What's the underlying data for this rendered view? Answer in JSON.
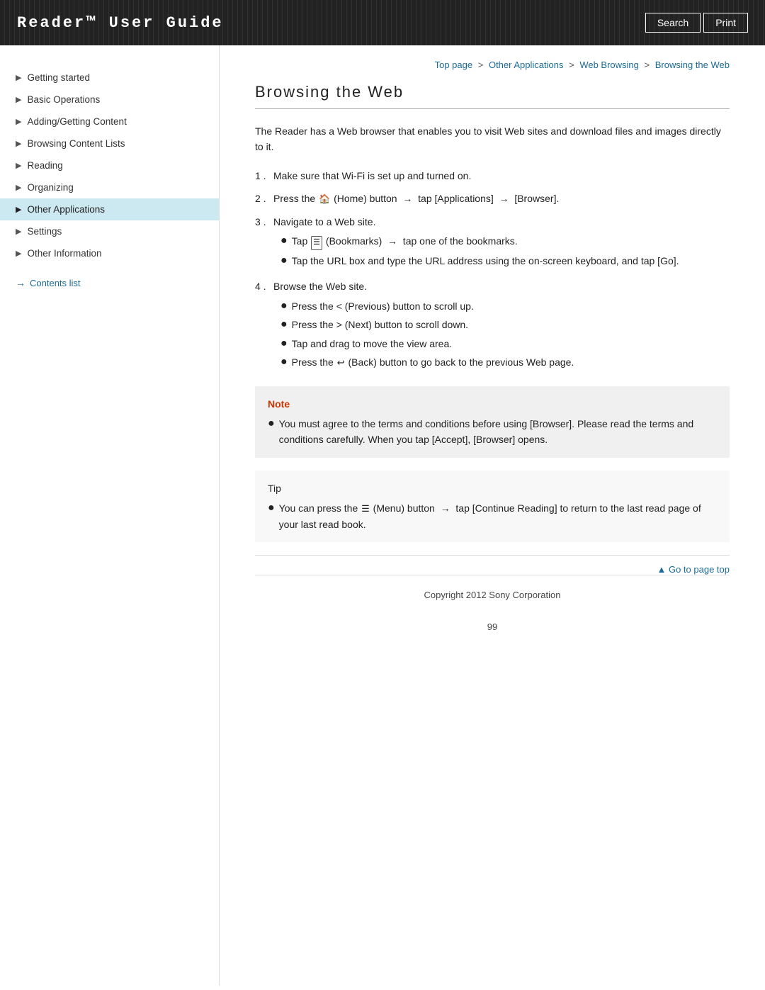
{
  "header": {
    "title": "Reader™ User Guide",
    "search_label": "Search",
    "print_label": "Print"
  },
  "breadcrumb": {
    "top": "Top page",
    "sep1": ">",
    "other_apps": "Other Applications",
    "sep2": ">",
    "web_browsing": "Web Browsing",
    "sep3": ">",
    "current": "Browsing the Web"
  },
  "sidebar": {
    "items": [
      {
        "label": "Getting started",
        "active": false
      },
      {
        "label": "Basic Operations",
        "active": false
      },
      {
        "label": "Adding/Getting Content",
        "active": false
      },
      {
        "label": "Browsing Content Lists",
        "active": false
      },
      {
        "label": "Reading",
        "active": false
      },
      {
        "label": "Organizing",
        "active": false
      },
      {
        "label": "Other Applications",
        "active": true
      },
      {
        "label": "Settings",
        "active": false
      },
      {
        "label": "Other Information",
        "active": false
      }
    ],
    "contents_link": "Contents list"
  },
  "main": {
    "page_title": "Browsing the Web",
    "intro": "The Reader has a Web browser that enables you to visit Web sites and download files and images directly to it.",
    "steps": [
      {
        "num": "1",
        "text": "Make sure that Wi-Fi is set up and turned on."
      },
      {
        "num": "2",
        "text": "Press the  (Home) button  →  tap [Applications]  →  [Browser]."
      },
      {
        "num": "3",
        "text": "Navigate to a Web site.",
        "sub": [
          "Tap  (Bookmarks)  →  tap one of the bookmarks.",
          "Tap the URL box and type the URL address using the on-screen keyboard, and tap [Go]."
        ]
      },
      {
        "num": "4",
        "text": "Browse the Web site.",
        "sub": [
          "Press the < (Previous) button to scroll up.",
          "Press the > (Next) button to scroll down.",
          "Tap and drag to move the view area.",
          "Press the  (Back) button to go back to the previous Web page."
        ]
      }
    ],
    "note": {
      "label": "Note",
      "text": "You must agree to the terms and conditions before using [Browser]. Please read the terms and conditions carefully. When you tap [Accept], [Browser] opens."
    },
    "tip": {
      "label": "Tip",
      "text": "You can press the  (Menu) button  →  tap [Continue Reading] to return to the last read page of your last read book."
    },
    "go_to_top": "▲ Go to page top",
    "footer": "Copyright 2012 Sony Corporation",
    "page_number": "99"
  }
}
